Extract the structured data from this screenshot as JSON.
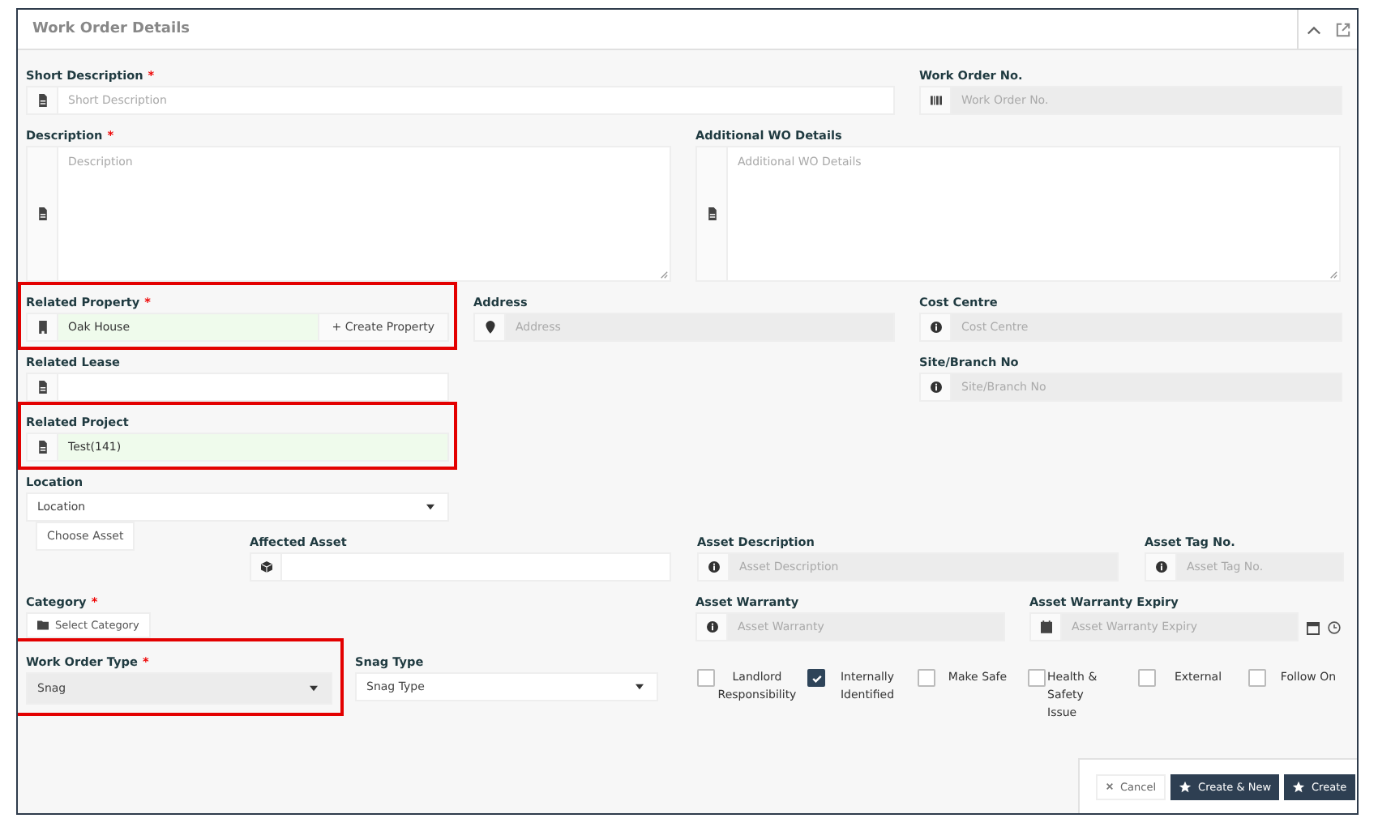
{
  "panel": {
    "title": "Work Order Details"
  },
  "rows": [
    [
      {
        "kind": "input",
        "label": "Short Description",
        "required_mark": "*",
        "placeholder": "Short Description",
        "readonly": false
      },
      {
        "kind": "input",
        "label": "Work Order No.",
        "placeholder": "Work Order No.",
        "readonly": true
      }
    ],
    [
      {
        "kind": "textarea",
        "label": "Description",
        "required_mark": "*",
        "placeholder": "Description"
      },
      {
        "kind": "textarea",
        "label": "Additional WO Details",
        "placeholder": "Additional WO Details"
      }
    ],
    [
      {
        "kind": "lookup",
        "label": "Related Property",
        "required_mark": "*",
        "value": "Oak House",
        "highlighted": true,
        "action": "+ Create Property"
      },
      {
        "kind": "input",
        "label": "Address",
        "placeholder": "Address",
        "readonly": true
      },
      {
        "kind": "input",
        "label": "Cost Centre",
        "placeholder": "Cost Centre",
        "readonly": true
      }
    ],
    [
      {
        "kind": "input",
        "label": "Related Lease",
        "readonly": false
      },
      {
        "kind": "spacer"
      },
      {
        "kind": "input",
        "label": "Site/Branch No",
        "placeholder": "Site/Branch No",
        "readonly": true
      }
    ],
    [
      {
        "kind": "lookup",
        "label": "Related Project",
        "value": "Test(141)",
        "highlighted": true
      }
    ],
    [
      {
        "kind": "select",
        "label": "Location",
        "placeholder": "Location",
        "readonly": false
      }
    ],
    [
      {
        "kind": "button",
        "text": "Choose Asset"
      },
      {
        "kind": "input",
        "label": "Affected Asset",
        "readonly": false
      },
      {
        "kind": "input",
        "label": "Asset Description",
        "placeholder": "Asset Description",
        "readonly": true
      },
      {
        "kind": "input",
        "label": "Asset Tag No.",
        "placeholder": "Asset Tag No.",
        "readonly": true
      }
    ],
    [
      {
        "kind": "button",
        "label": "Category",
        "required_mark": "*",
        "text": "Select Category"
      },
      {
        "kind": "input",
        "label": "Asset Warranty",
        "placeholder": "Asset Warranty",
        "readonly": true
      },
      {
        "kind": "datetime",
        "label": "Asset Warranty Expiry",
        "placeholder": "Asset Warranty Expiry",
        "readonly": true
      }
    ],
    [
      {
        "kind": "select",
        "label": "Work Order Type",
        "required_mark": "*",
        "value": "Snag",
        "highlighted": true,
        "readonly": true
      },
      {
        "kind": "select",
        "label": "Snag Type",
        "placeholder": "Snag Type",
        "readonly": false
      },
      {
        "kind": "checkboxes",
        "options": [
          {
            "label": "Landlord Responsibility",
            "checked": false
          },
          {
            "label": "Internally Identified",
            "checked": true
          },
          {
            "label": "Make Safe",
            "checked": false
          },
          {
            "label": "Health & Safety Issue",
            "checked": false
          },
          {
            "label": "External",
            "checked": false
          },
          {
            "label": "Follow On",
            "checked": false
          }
        ]
      }
    ]
  ],
  "footer": {
    "buttons": [
      {
        "label": "Cancel",
        "kind": "cancel"
      },
      {
        "label": "Create & New",
        "kind": "primary"
      },
      {
        "label": "Create",
        "kind": "primary"
      }
    ]
  }
}
